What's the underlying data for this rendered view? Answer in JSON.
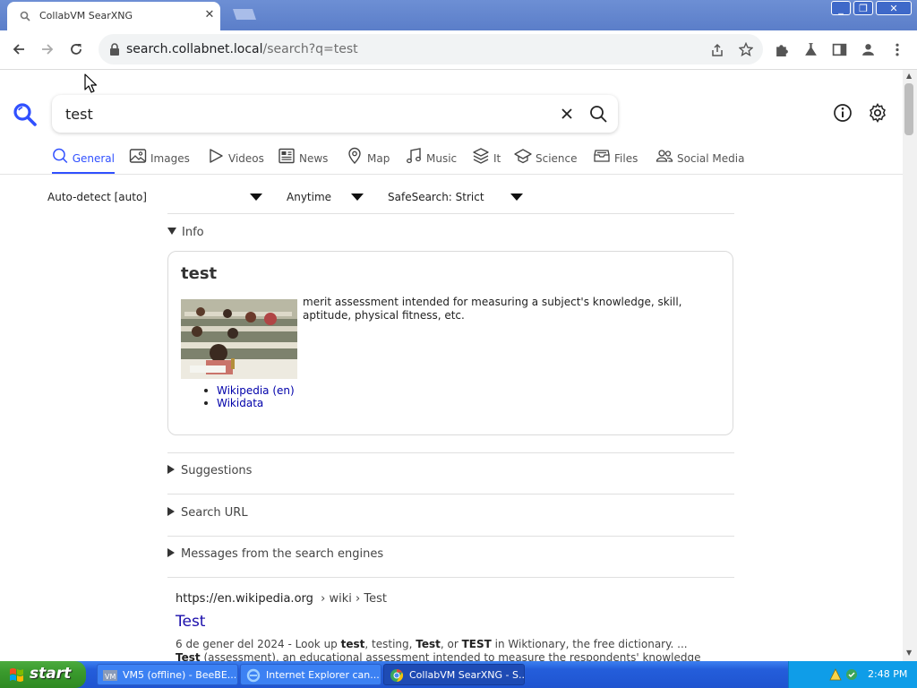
{
  "browser": {
    "tab_title": "CollabVM SearXNG",
    "url_host": "search.collabnet.local",
    "url_path": "/search?q=test",
    "win_min": "_",
    "win_max": "❐",
    "win_close": "✕"
  },
  "search": {
    "query": "test",
    "categories": [
      {
        "label": "General",
        "icon": "search-icon",
        "active": true
      },
      {
        "label": "Images",
        "icon": "image-icon"
      },
      {
        "label": "Videos",
        "icon": "play-icon"
      },
      {
        "label": "News",
        "icon": "newspaper-icon"
      },
      {
        "label": "Map",
        "icon": "map-pin-icon"
      },
      {
        "label": "Music",
        "icon": "music-note-icon"
      },
      {
        "label": "It",
        "icon": "layers-icon"
      },
      {
        "label": "Science",
        "icon": "school-icon"
      },
      {
        "label": "Files",
        "icon": "file-tray-icon"
      },
      {
        "label": "Social Media",
        "icon": "people-icon"
      }
    ],
    "filters": {
      "language": "Auto-detect [auto]",
      "time_range": "Anytime",
      "safesearch": "SafeSearch: Strict"
    }
  },
  "infobox": {
    "section_label": "Info",
    "title": "test",
    "description": "merit assessment intended for measuring a subject's knowledge, skill, aptitude, physical fitness, etc.",
    "links": [
      "Wikipedia (en)",
      "Wikidata"
    ]
  },
  "sections": {
    "suggestions": "Suggestions",
    "search_url": "Search URL",
    "engine_messages": "Messages from the search engines"
  },
  "result": {
    "url": "https://en.wikipedia.org",
    "breadcrumb": "› wiki › Test",
    "title": "Test",
    "snippet_date": "6 de gener del 2024 - Look up",
    "snippet_b1": "test",
    "snippet_t1": ", testing,",
    "snippet_b2": "Test",
    "snippet_t2": ", or",
    "snippet_b3": "TEST",
    "snippet_t3": "in Wiktionary, the free dictionary. ...",
    "snippet_b4": "Test",
    "snippet_line2": "(assessment), an educational assessment intended to measure the respondents' knowledge or other"
  },
  "taskbar": {
    "start_label": "start",
    "tasks": [
      {
        "label": "VM5 (offline) - BeeBE..."
      },
      {
        "label": "Internet Explorer can..."
      },
      {
        "label": "CollabVM SearXNG - S..."
      }
    ],
    "clock": "2:48 PM"
  }
}
